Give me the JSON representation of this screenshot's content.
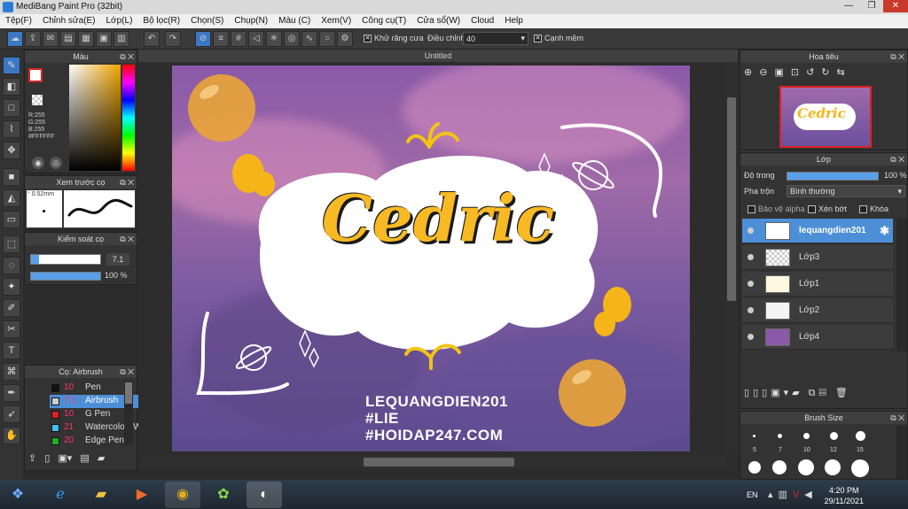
{
  "app": {
    "title": "MediBang Paint Pro (32bit)"
  },
  "menu": [
    "Tệp(F)",
    "Chỉnh sửa(E)",
    "Lớp(L)",
    "Bộ lọc(R)",
    "Chọn(S)",
    "Chụp(N)",
    "Màu (C)",
    "Xem(V)",
    "Công cụ(T)",
    "Cửa sổ(W)",
    "Cloud",
    "Help"
  ],
  "toolbar": {
    "antialias_label": "Khử răng cưa",
    "adjust_label": "Điều chỉnh",
    "adjust_value": "40",
    "edge_label": "Cạnh mềm"
  },
  "canvas": {
    "tab_title": "Untitled"
  },
  "artwork": {
    "title": "Cedric",
    "line1": "LEQUANGDIEN201",
    "line2": "#LIE",
    "line3": "#HOIDAP247.COM"
  },
  "color_panel": {
    "title": "Màu",
    "r": "R:255",
    "g": "G:255",
    "b": "B:255",
    "hex": "#FFFFFF"
  },
  "preview_panel": {
    "title": "Xem trước cọ",
    "size": "0.52mm"
  },
  "brush_control": {
    "title": "Kiểm soát cọ",
    "size_value": "7.1",
    "opacity_value": "100 %"
  },
  "brush_panel": {
    "title": "Cọ: Airbrush",
    "items": [
      {
        "size": "10",
        "name": "Pen",
        "color": "#111111"
      },
      {
        "size": "7.1",
        "name": "Airbrush",
        "color": "#cccccc"
      },
      {
        "size": "10",
        "name": "G Pen",
        "color": "#e02020"
      },
      {
        "size": "21",
        "name": "Watercolor (Wet",
        "color": "#40c0f0"
      },
      {
        "size": "20",
        "name": "Edge Pen",
        "color": "#20b020"
      }
    ]
  },
  "navigator": {
    "title": "Hoa tiêu"
  },
  "layer_panel": {
    "title": "Lớp",
    "opacity_label": "Độ trong",
    "opacity_value": "100 %",
    "blend_label": "Pha trộn",
    "blend_value": "Bình thường",
    "protect_alpha": "Bảo vệ alpha",
    "clipping": "Xén bớt",
    "lock": "Khóa",
    "layers": [
      "lequangdien201",
      "Lớp3",
      "Lớp1",
      "Lớp2",
      "Lớp4"
    ]
  },
  "brush_size_panel": {
    "title": "Brush Size",
    "sizes": [
      "5",
      "7",
      "10",
      "12",
      "15"
    ]
  },
  "taskbar": {
    "lang": "EN",
    "time": "4:20 PM",
    "date": "29/11/2021"
  }
}
